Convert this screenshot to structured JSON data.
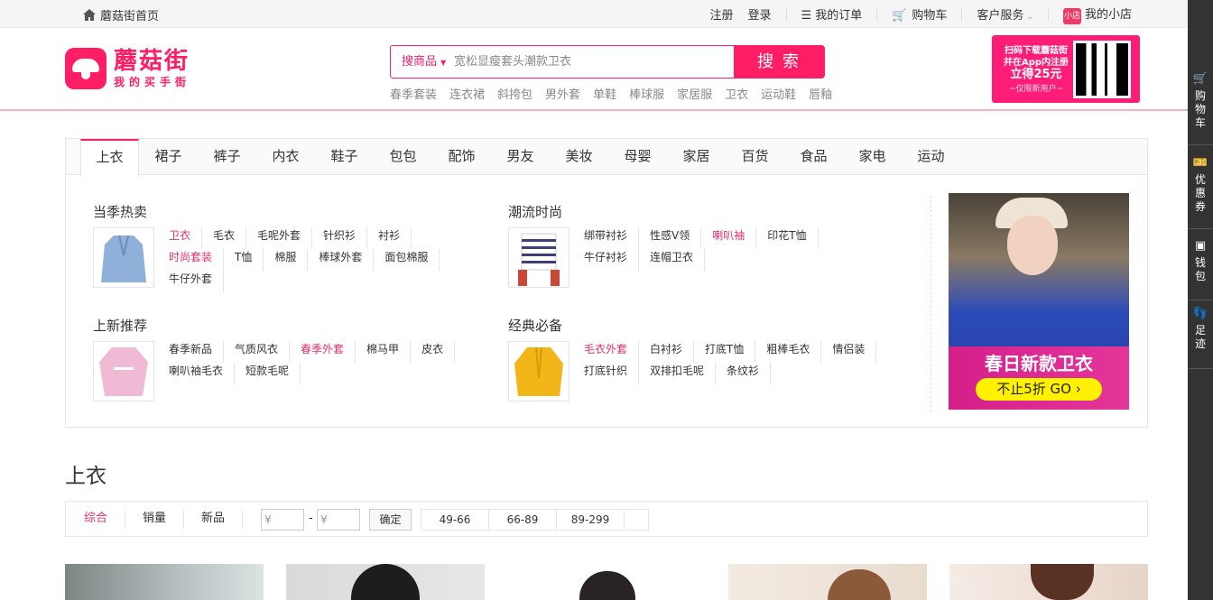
{
  "topbar": {
    "home": "蘑菇街首页",
    "register": "注册",
    "login": "登录",
    "orders": "我的订单",
    "cart": "购物车",
    "service": "客户服务",
    "shop_badge": "小店",
    "shop": "我的小店"
  },
  "logo": {
    "name": "蘑菇街",
    "slogan": "我的买手街"
  },
  "search": {
    "scope": "搜商品",
    "placeholder": "宽松显瘦套头潮款卫衣",
    "button": "搜索",
    "hot": [
      "春季套装",
      "连衣裙",
      "斜挎包",
      "男外套",
      "单鞋",
      "棒球服",
      "家居服",
      "卫衣",
      "运动鞋",
      "唇釉"
    ]
  },
  "promo": {
    "line1": "扫码下载蘑菇街",
    "line2": "并在App内注册",
    "line3": "立得25元",
    "line4": "~仅限新用户~"
  },
  "sidebar": [
    "购物车",
    "优惠券",
    "钱包",
    "足迹"
  ],
  "tabs": [
    "上衣",
    "裙子",
    "裤子",
    "内衣",
    "鞋子",
    "包包",
    "配饰",
    "男友",
    "美妆",
    "母婴",
    "家居",
    "百货",
    "食品",
    "家电",
    "运动"
  ],
  "groups": [
    {
      "title": "当季热卖",
      "links": [
        {
          "t": "卫衣",
          "hl": true
        },
        {
          "t": "毛衣"
        },
        {
          "t": "毛呢外套"
        },
        {
          "t": "针织衫"
        },
        {
          "t": "衬衫"
        },
        {
          "t": "时尚套装",
          "hl": true
        },
        {
          "t": "T恤"
        },
        {
          "t": "棉服"
        },
        {
          "t": "棒球外套"
        },
        {
          "t": "面包棉服"
        },
        {
          "t": "牛仔外套"
        }
      ]
    },
    {
      "title": "潮流时尚",
      "links": [
        {
          "t": "绑带衬衫"
        },
        {
          "t": "性感V领"
        },
        {
          "t": "喇叭袖",
          "hl": true
        },
        {
          "t": "印花T恤"
        },
        {
          "t": "牛仔衬衫"
        },
        {
          "t": "连帽卫衣"
        }
      ]
    },
    {
      "title": "上新推荐",
      "links": [
        {
          "t": "春季新品"
        },
        {
          "t": "气质风衣"
        },
        {
          "t": "春季外套",
          "hl": true
        },
        {
          "t": "棉马甲"
        },
        {
          "t": "皮衣"
        },
        {
          "t": "喇叭袖毛衣"
        },
        {
          "t": "短款毛呢"
        }
      ]
    },
    {
      "title": "经典必备",
      "links": [
        {
          "t": "毛衣外套",
          "hl": true
        },
        {
          "t": "白衬衫"
        },
        {
          "t": "打底T恤"
        },
        {
          "t": "粗棒毛衣"
        },
        {
          "t": "情侣装"
        },
        {
          "t": "打底针织"
        },
        {
          "t": "双排扣毛呢"
        },
        {
          "t": "条纹衫"
        }
      ]
    }
  ],
  "banner": {
    "title": "春日新款卫衣",
    "cta": "不止5折 GO"
  },
  "section_title": "上衣",
  "filter": {
    "sorts": [
      "综合",
      "销量",
      "新品"
    ],
    "price_min": "¥",
    "price_max": "¥",
    "dash": "-",
    "confirm": "确定",
    "ranges": [
      "49-66",
      "66-89",
      "89-299"
    ]
  }
}
